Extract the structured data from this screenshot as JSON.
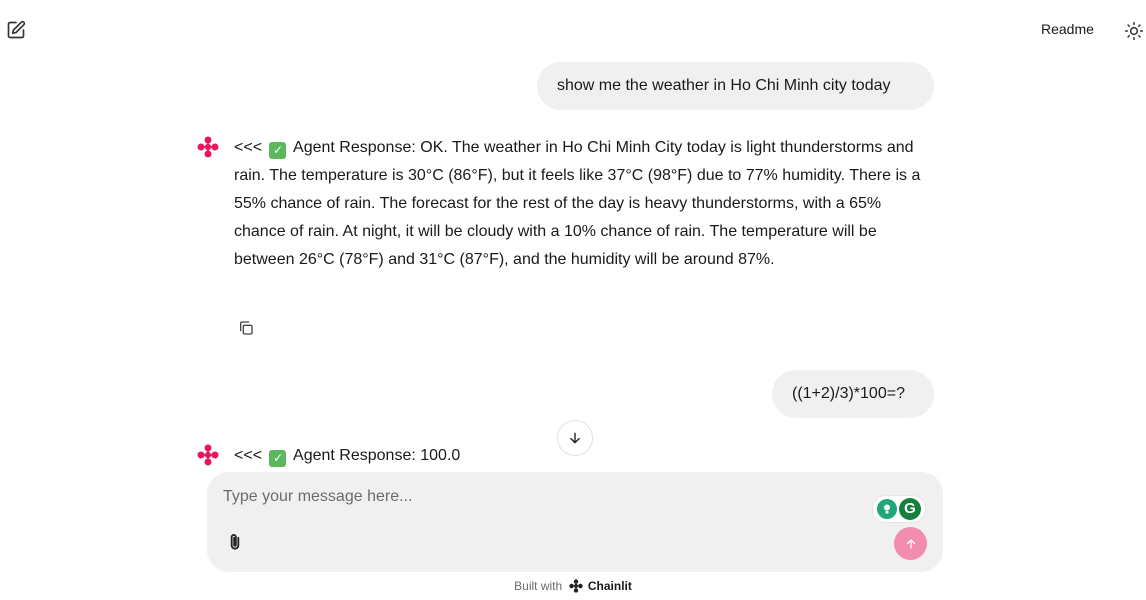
{
  "header": {
    "new_chat_icon": "edit-icon",
    "readme_label": "Readme",
    "theme_icon": "sun-icon"
  },
  "messages": [
    {
      "role": "user",
      "text": "show me the weather in Ho Chi Minh city today"
    },
    {
      "role": "assistant",
      "prefix": "<<<",
      "icon": "checkmark-emoji",
      "text": "Agent Response: OK. The weather in Ho Chi Minh City today is light thunderstorms and rain. The temperature is 30°C (86°F), but it feels like 37°C (98°F) due to 77% humidity. There is a 55% chance of rain. The forecast for the rest of the day is heavy thunderstorms, with a 65% chance of rain. At night, it will be cloudy with a 10% chance of rain. The temperature will be between 26°C (78°F) and 31°C (87°F), and the humidity will be around 87%."
    },
    {
      "role": "user",
      "text": "((1+2)/3)*100=?"
    },
    {
      "role": "assistant",
      "prefix": "<<<",
      "icon": "checkmark-emoji",
      "text": "Agent Response: 100.0"
    }
  ],
  "composer": {
    "placeholder": "Type your message here...",
    "value": ""
  },
  "footer": {
    "built_with": "Built with",
    "brand": "Chainlit"
  },
  "colors": {
    "accent": "#e8175d",
    "send_button": "#f28db0",
    "bubble_bg": "#f0f0f0"
  }
}
